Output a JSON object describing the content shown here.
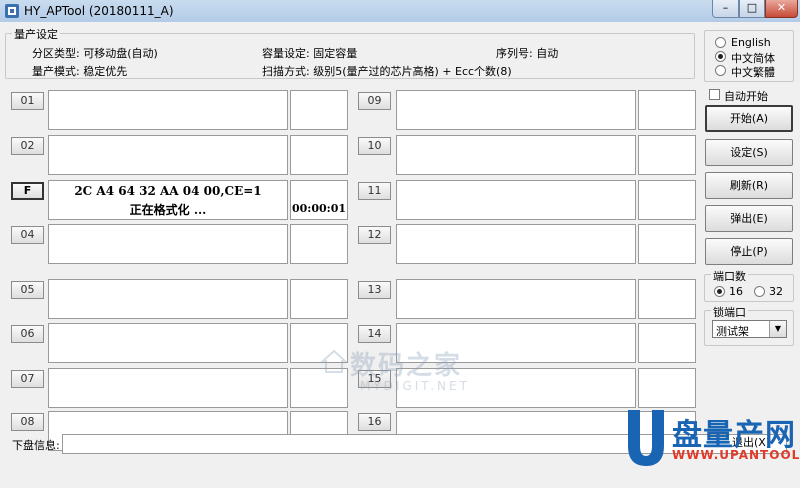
{
  "window": {
    "title": "HY_APTool (20180111_A)",
    "close_glyph": "✕",
    "max_glyph": "□",
    "min_glyph": "–"
  },
  "settings": {
    "legend": "量产设定",
    "partition": "分区类型: 可移动盘(自动)",
    "mode": "量产模式: 稳定优先",
    "capacity": "容量设定: 固定容量",
    "scan": "扫描方式: 级别5(量产过的芯片高格) + Ecc个数(8)",
    "serial": "序列号:  自动"
  },
  "language": {
    "options": [
      {
        "label": "English",
        "selected": false
      },
      {
        "label": "中文简体",
        "selected": true
      },
      {
        "label": "中文繁體",
        "selected": false
      }
    ]
  },
  "ports_left": [
    {
      "label": "01",
      "line1": "",
      "line2": "",
      "time": "",
      "active": false
    },
    {
      "label": "02",
      "line1": "",
      "line2": "",
      "time": "",
      "active": false
    },
    {
      "label": "F",
      "line1": "2C A4 64 32 AA 04 00,CE=1",
      "line2": "正在格式化 ...",
      "time": "00:00:01",
      "active": true
    },
    {
      "label": "04",
      "line1": "",
      "line2": "",
      "time": "",
      "active": false
    },
    {
      "label": "05",
      "line1": "",
      "line2": "",
      "time": "",
      "active": false
    },
    {
      "label": "06",
      "line1": "",
      "line2": "",
      "time": "",
      "active": false
    },
    {
      "label": "07",
      "line1": "",
      "line2": "",
      "time": "",
      "active": false
    },
    {
      "label": "08",
      "line1": "",
      "line2": "",
      "time": "",
      "active": false
    }
  ],
  "ports_right": [
    {
      "label": "09"
    },
    {
      "label": "10"
    },
    {
      "label": "11"
    },
    {
      "label": "12"
    },
    {
      "label": "13"
    },
    {
      "label": "14"
    },
    {
      "label": "15"
    },
    {
      "label": "16"
    }
  ],
  "controls": {
    "auto_start": {
      "label": "自动开始",
      "checked": false
    },
    "buttons": [
      "开始(A)",
      "设定(S)",
      "刷新(R)",
      "弹出(E)",
      "停止(P)"
    ],
    "port_count": {
      "legend": "端口数",
      "options": [
        {
          "label": "16",
          "selected": true
        },
        {
          "label": "32",
          "selected": false
        }
      ]
    },
    "lock_port": {
      "legend": "锁端口",
      "value": "测试架",
      "arrow": "▼"
    }
  },
  "bottom": {
    "info_label": "下盘信息:",
    "exit_label": "退出(X)"
  },
  "watermarks": {
    "center_title": "数码之家",
    "center_sub": "MYDIGIT.NET",
    "logo_title": "盘量产网",
    "logo_url": "WWW.UPANTOOL.COM"
  },
  "colors": {
    "logo_blue": "#1a64b4",
    "logo_red": "#e03a2a",
    "close_red": "#c74a36"
  }
}
